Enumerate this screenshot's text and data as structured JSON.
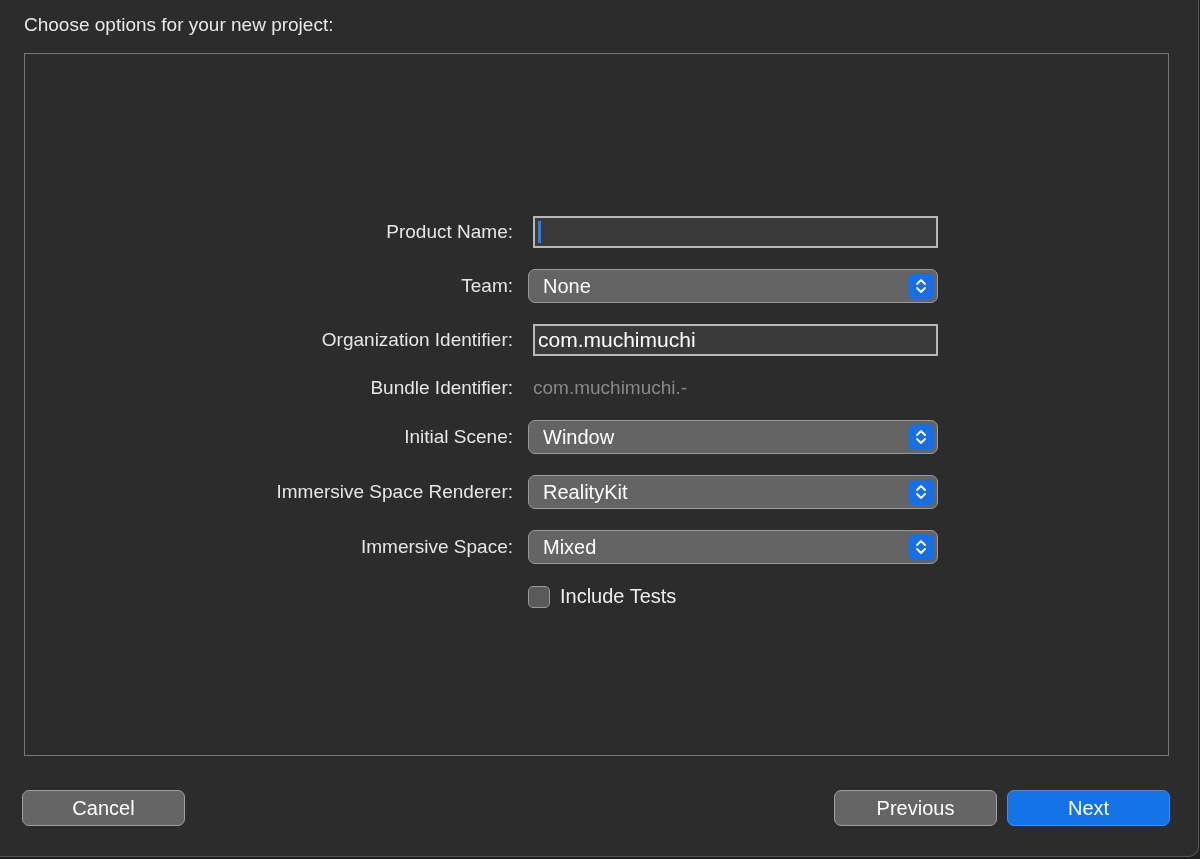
{
  "window": {
    "title": "Choose options for your new project:"
  },
  "form": {
    "rows": [
      {
        "kind": "text",
        "label": "Product Name:",
        "focused": true
      },
      {
        "kind": "popup",
        "label": "Team:",
        "value": "None"
      },
      {
        "kind": "text",
        "label": "Organization Identifier:",
        "value": "com.muchimuchi",
        "focused": false
      },
      {
        "kind": "static",
        "label": "Bundle Identifier:",
        "value": "com.muchimuchi.-"
      },
      {
        "kind": "popup",
        "label": "Initial Scene:",
        "value": "Window"
      },
      {
        "kind": "popup",
        "label": "Immersive Space Renderer:",
        "value": "RealityKit"
      },
      {
        "kind": "popup",
        "label": "Immersive Space:",
        "value": "Mixed"
      },
      {
        "kind": "checkbox",
        "label": "Include Tests",
        "checked": false
      }
    ]
  },
  "buttons": [
    {
      "label": "Cancel",
      "primary": false
    },
    {
      "label": "Previous",
      "primary": false
    },
    {
      "label": "Next",
      "primary": true
    }
  ]
}
